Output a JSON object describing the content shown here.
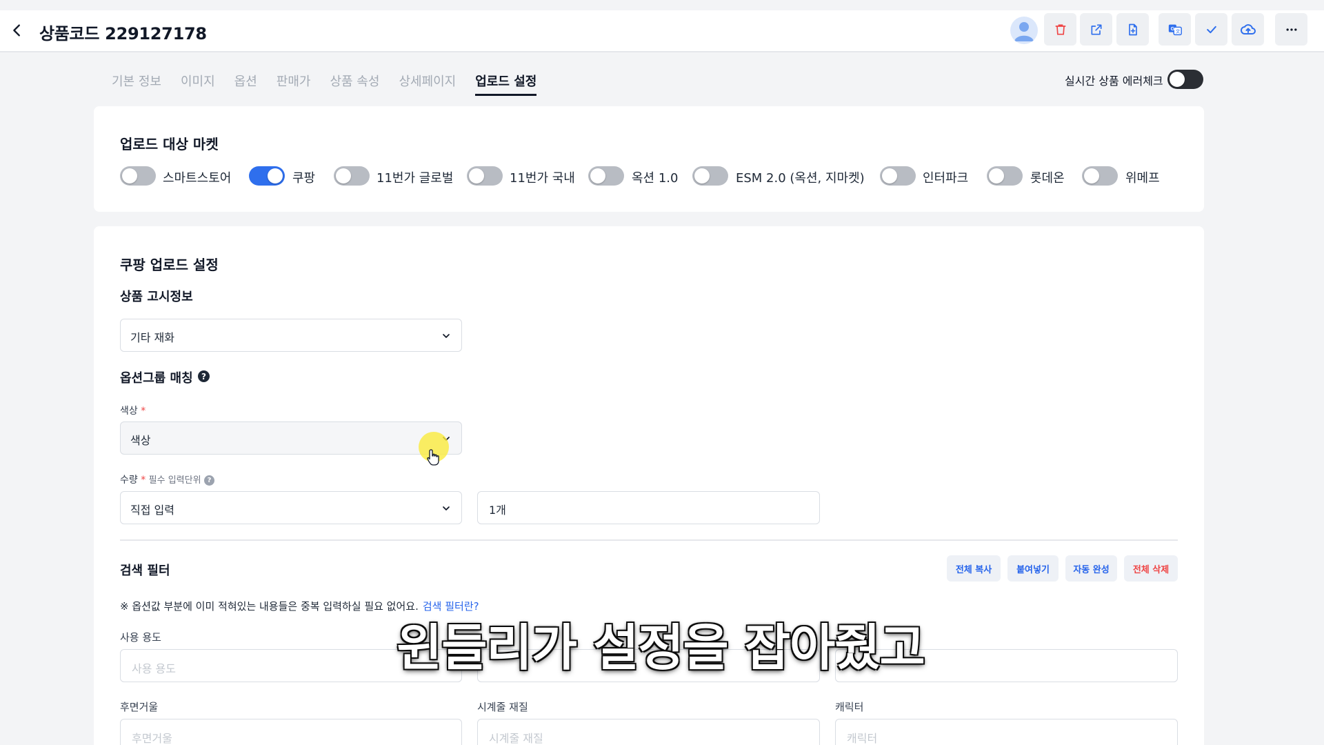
{
  "header": {
    "title": "상품코드 229127178"
  },
  "tabs": [
    {
      "label": "기본 정보",
      "active": false
    },
    {
      "label": "이미지",
      "active": false
    },
    {
      "label": "옵션",
      "active": false
    },
    {
      "label": "판매가",
      "active": false
    },
    {
      "label": "상품 속성",
      "active": false
    },
    {
      "label": "상세페이지",
      "active": false
    },
    {
      "label": "업로드 설정",
      "active": true
    }
  ],
  "realtime_check": {
    "label": "실시간 상품 에러체크",
    "enabled": false
  },
  "markets": {
    "title": "업로드 대상 마켓",
    "items": [
      {
        "label": "스마트스토어",
        "enabled": false
      },
      {
        "label": "쿠팡",
        "enabled": true
      },
      {
        "label": "11번가 글로벌",
        "enabled": false
      },
      {
        "label": "11번가 국내",
        "enabled": false
      },
      {
        "label": "옥션 1.0",
        "enabled": false
      },
      {
        "label": "ESM 2.0 (옥션, 지마켓)",
        "enabled": false
      },
      {
        "label": "인터파크",
        "enabled": false
      },
      {
        "label": "롯데온",
        "enabled": false
      },
      {
        "label": "위메프",
        "enabled": false
      }
    ]
  },
  "coupang": {
    "title": "쿠팡 업로드 설정",
    "notice": {
      "label": "상품 고시정보",
      "value": "기타 재화"
    },
    "option_group": {
      "label": "옵션그룹 매칭",
      "color": {
        "label": "색상",
        "required_mark": "*",
        "value": "색상"
      },
      "quantity": {
        "label": "수량",
        "required_mark": "*",
        "hint": "필수 입력단위",
        "select_value": "직접 입력",
        "input_value": "1개"
      }
    },
    "search_filter": {
      "title": "검색 필터",
      "buttons": {
        "copy_all": "전체 복사",
        "paste": "붙여넣기",
        "autocomplete": "자동 완성",
        "delete_all": "전체 삭제"
      },
      "note": "※ 옵션값 부분에 이미 적혀있는 내용들은 중복 입력하실 필요 없어요.",
      "note_link": "검색 필터란?",
      "fields": [
        {
          "label": "사용 용도",
          "placeholder": "사용 용도"
        },
        {
          "label": "",
          "placeholder": ""
        },
        {
          "label": "",
          "placeholder": ""
        },
        {
          "label": "후면거울",
          "placeholder": "후면거울"
        },
        {
          "label": "시계줄 재질",
          "placeholder": "시계줄 재질"
        },
        {
          "label": "캐릭터",
          "placeholder": "캐릭터"
        }
      ]
    }
  },
  "caption": "윈들리가 설정을 잡아줬고",
  "colors": {
    "accent": "#2f6fed",
    "danger": "#ef4444",
    "link": "#2563eb"
  }
}
